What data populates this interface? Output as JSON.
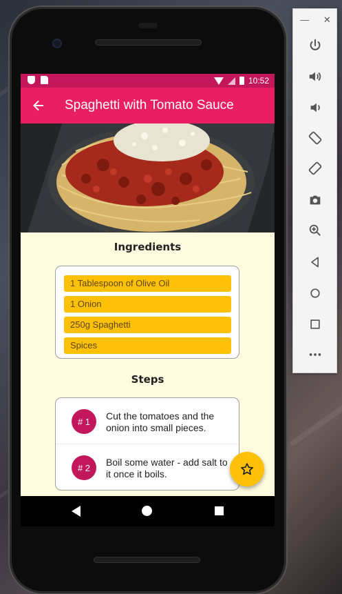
{
  "status_bar": {
    "time": "10:52"
  },
  "app_bar": {
    "title": "Spaghetti with Tomato Sauce",
    "back_icon": "arrow-back-icon"
  },
  "hero_image": {
    "subject": "spaghetti-with-tomato-sauce-photo"
  },
  "ingredients": {
    "title": "Ingredients",
    "items": [
      "1 Tablespoon of Olive Oil",
      "1 Onion",
      "250g Spaghetti",
      "Spices"
    ]
  },
  "steps": {
    "title": "Steps",
    "items": [
      {
        "number": "# 1",
        "text": "Cut the tomatoes and the onion into small pieces."
      },
      {
        "number": "# 2",
        "text": "Boil some water - add salt to it once it boils."
      }
    ]
  },
  "fab": {
    "icon": "star-outline-icon"
  },
  "colors": {
    "primary": "#e91e63",
    "primary_dark": "#c2185b",
    "accent": "#ffc107",
    "background": "#fffbdf"
  },
  "emulator_toolbar": {
    "window_controls": [
      "minimize",
      "close"
    ],
    "buttons": [
      "power-icon",
      "volume-up-icon",
      "volume-down-icon",
      "rotate-left-icon",
      "rotate-right-icon",
      "camera-icon",
      "zoom-icon",
      "back-icon",
      "home-icon",
      "overview-icon",
      "more-icon"
    ]
  }
}
